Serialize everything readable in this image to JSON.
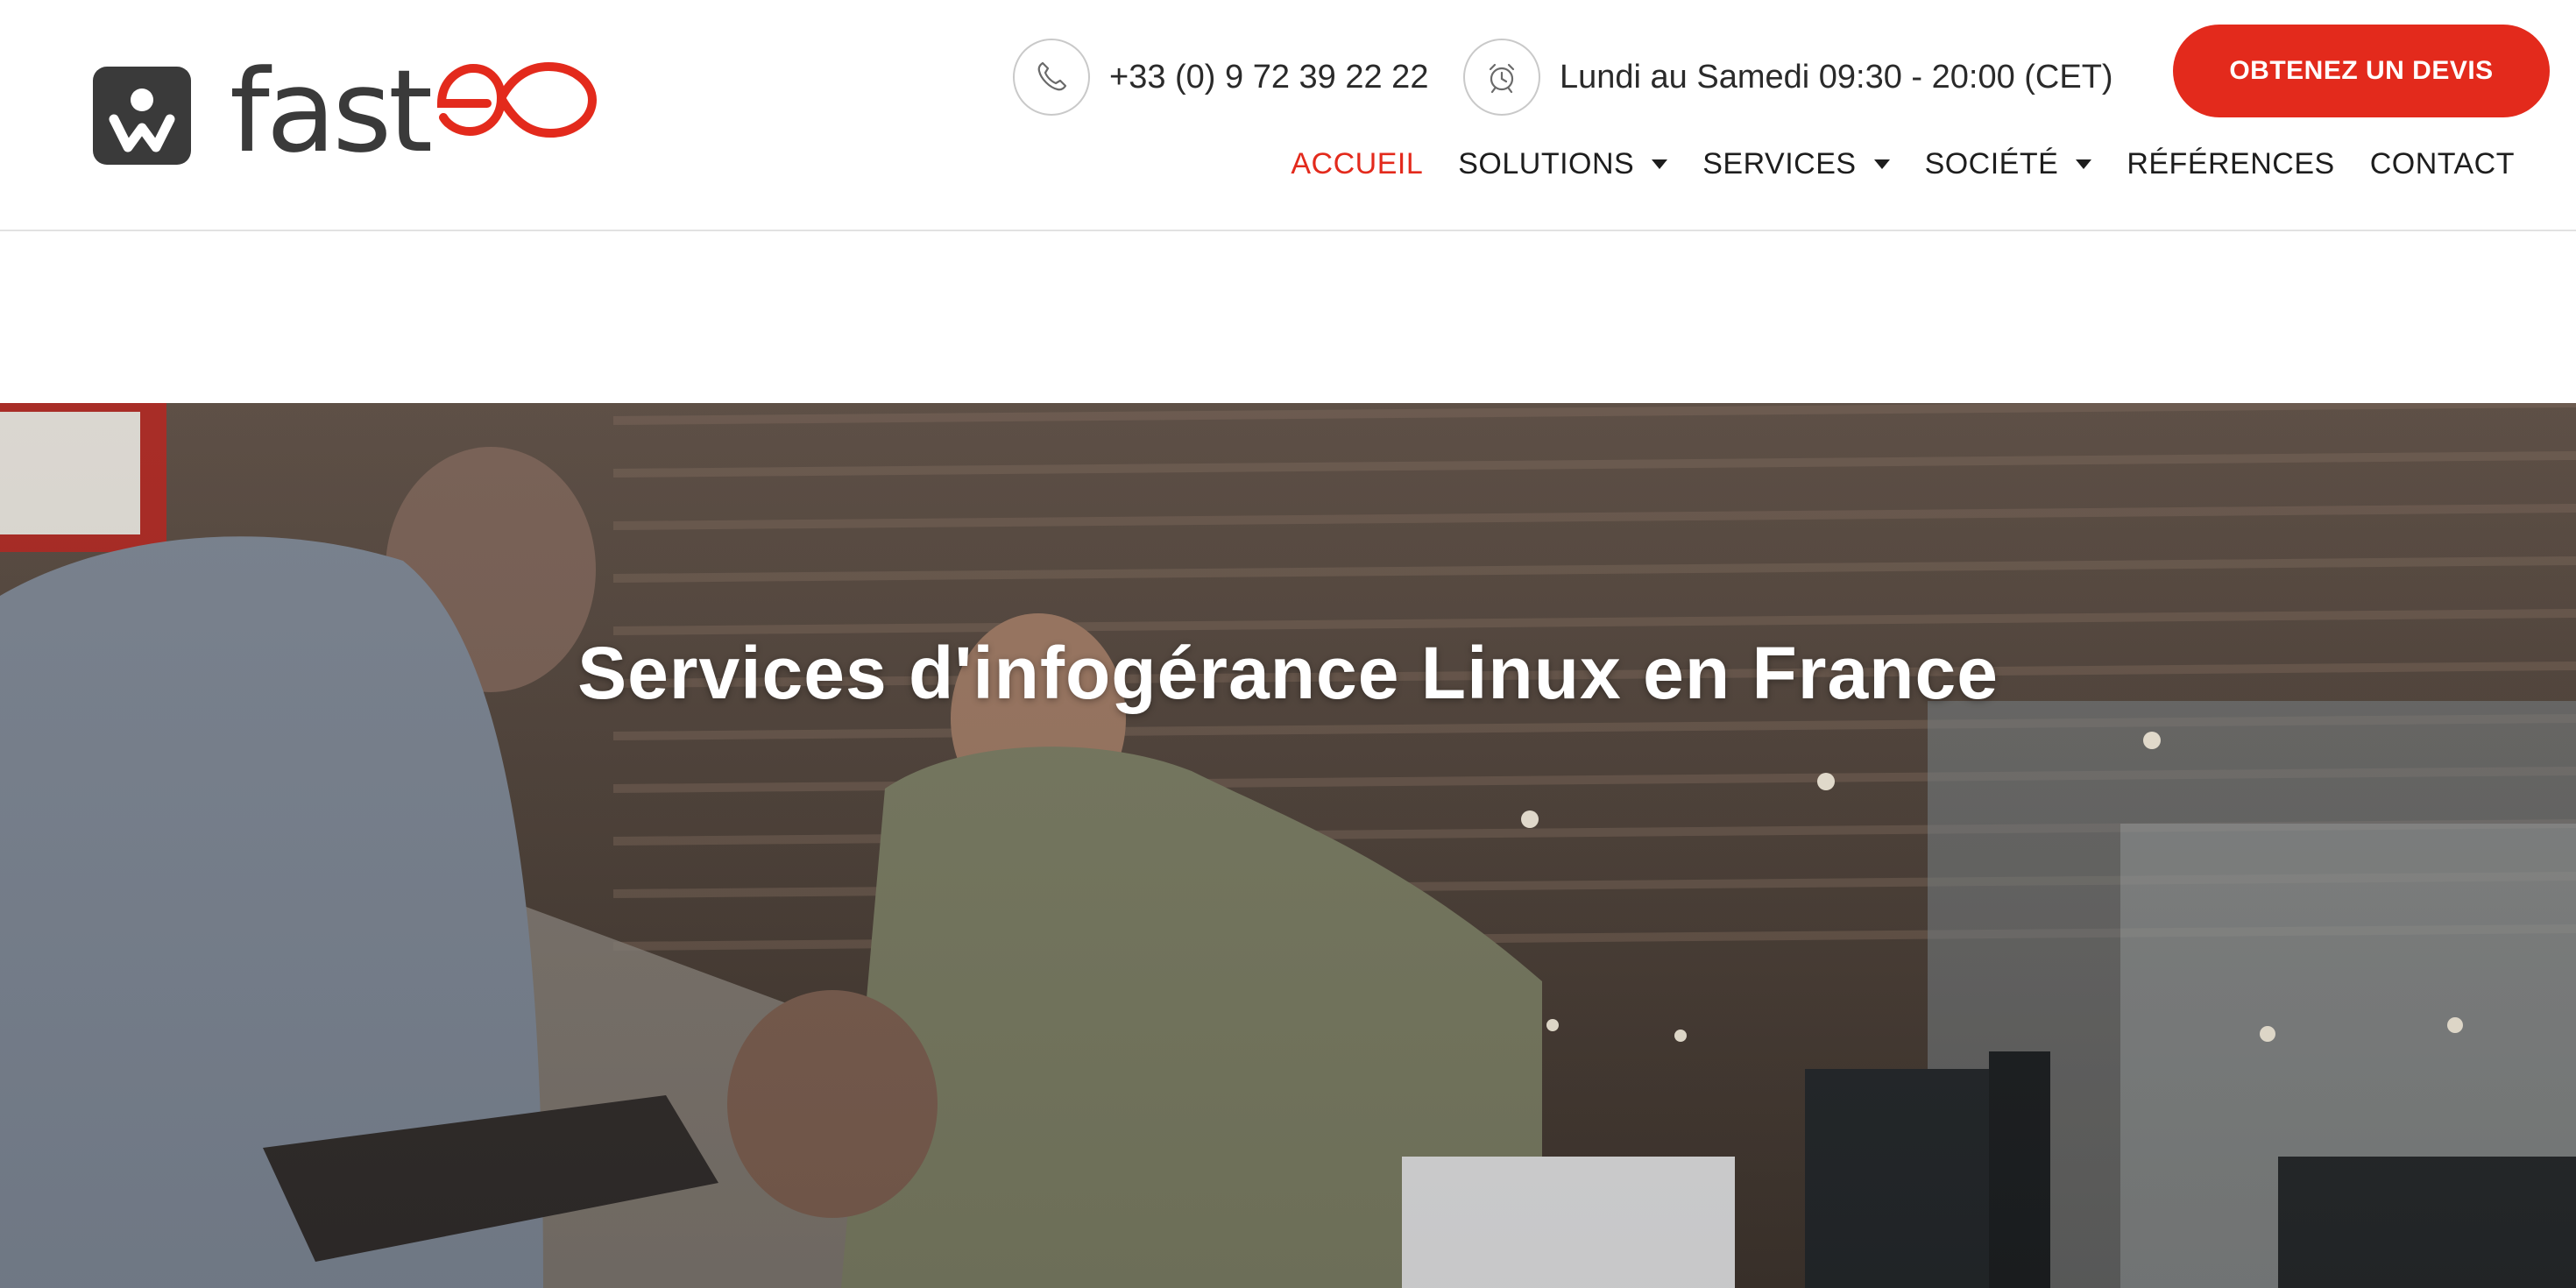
{
  "logo": {
    "wordmark_dark": "fast",
    "wordmark_accent": "eo",
    "colors": {
      "dark": "#3a3a3a",
      "accent": "#e32a1c"
    }
  },
  "topbar": {
    "phone": {
      "icon": "phone-icon",
      "text": "+33 (0) 9 72 39 22 22"
    },
    "hours": {
      "icon": "alarm-clock-icon",
      "text": "Lundi au Samedi 09:30 - 20:00 (CET)"
    },
    "cta_label": "OBTENEZ UN DEVIS"
  },
  "nav": {
    "items": [
      {
        "label": "ACCUEIL",
        "active": true,
        "has_dropdown": false
      },
      {
        "label": "SOLUTIONS",
        "active": false,
        "has_dropdown": true
      },
      {
        "label": "SERVICES",
        "active": false,
        "has_dropdown": true
      },
      {
        "label": "SOCIÉTÉ",
        "active": false,
        "has_dropdown": true
      },
      {
        "label": "RÉFÉRENCES",
        "active": false,
        "has_dropdown": false
      },
      {
        "label": "CONTACT",
        "active": false,
        "has_dropdown": false
      }
    ]
  },
  "hero": {
    "title": "Services d'infogérance Linux en France"
  },
  "colors": {
    "accent": "#e32a1c",
    "text_dark": "#1d1d1d",
    "header_bg": "#ffffff",
    "hero_overlay": "#4b4038"
  }
}
